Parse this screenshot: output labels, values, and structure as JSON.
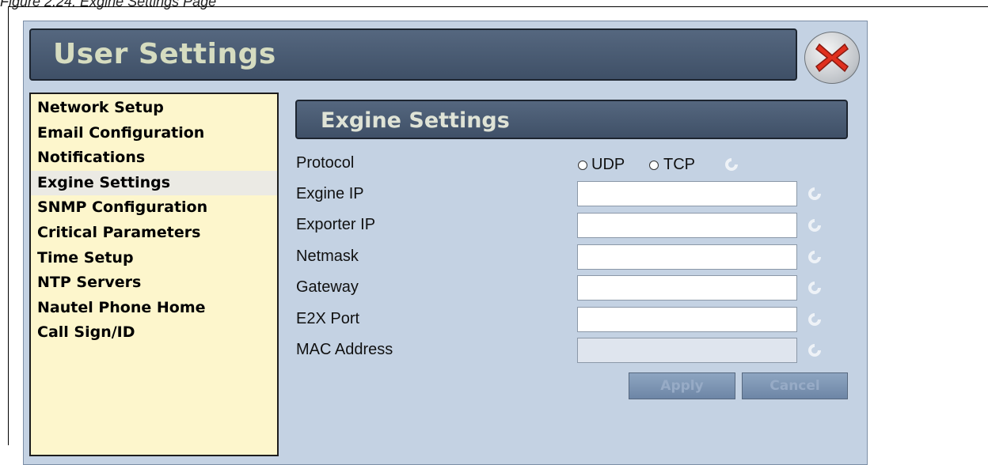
{
  "caption": "Figure 2.24: Exgine Settings Page",
  "window": {
    "title": "User Settings",
    "close_icon": "close-icon"
  },
  "sidebar": {
    "items": [
      {
        "label": "Network Setup"
      },
      {
        "label": "Email Configuration"
      },
      {
        "label": "Notifications"
      },
      {
        "label": "Exgine Settings",
        "active": true
      },
      {
        "label": "SNMP Configuration"
      },
      {
        "label": "Critical Parameters"
      },
      {
        "label": "Time Setup"
      },
      {
        "label": "NTP Servers"
      },
      {
        "label": "Nautel Phone Home"
      },
      {
        "label": "Call Sign/ID"
      }
    ]
  },
  "section": {
    "title": "Exgine Settings"
  },
  "form": {
    "protocol": {
      "label": "Protocol",
      "options": [
        "UDP",
        "TCP"
      ],
      "selected": ""
    },
    "fields": [
      {
        "label": "Exgine IP",
        "value": ""
      },
      {
        "label": "Exporter IP",
        "value": ""
      },
      {
        "label": "Netmask",
        "value": ""
      },
      {
        "label": "Gateway",
        "value": ""
      },
      {
        "label": "E2X Port",
        "value": ""
      },
      {
        "label": "MAC Address",
        "value": "",
        "disabled": true
      }
    ]
  },
  "buttons": {
    "apply": "Apply",
    "cancel": "Cancel"
  },
  "colors": {
    "panel": "#c4d2e3",
    "titlebar": "#4a5b72",
    "sidebar": "#fdf6cc",
    "close": "#e0301e"
  }
}
